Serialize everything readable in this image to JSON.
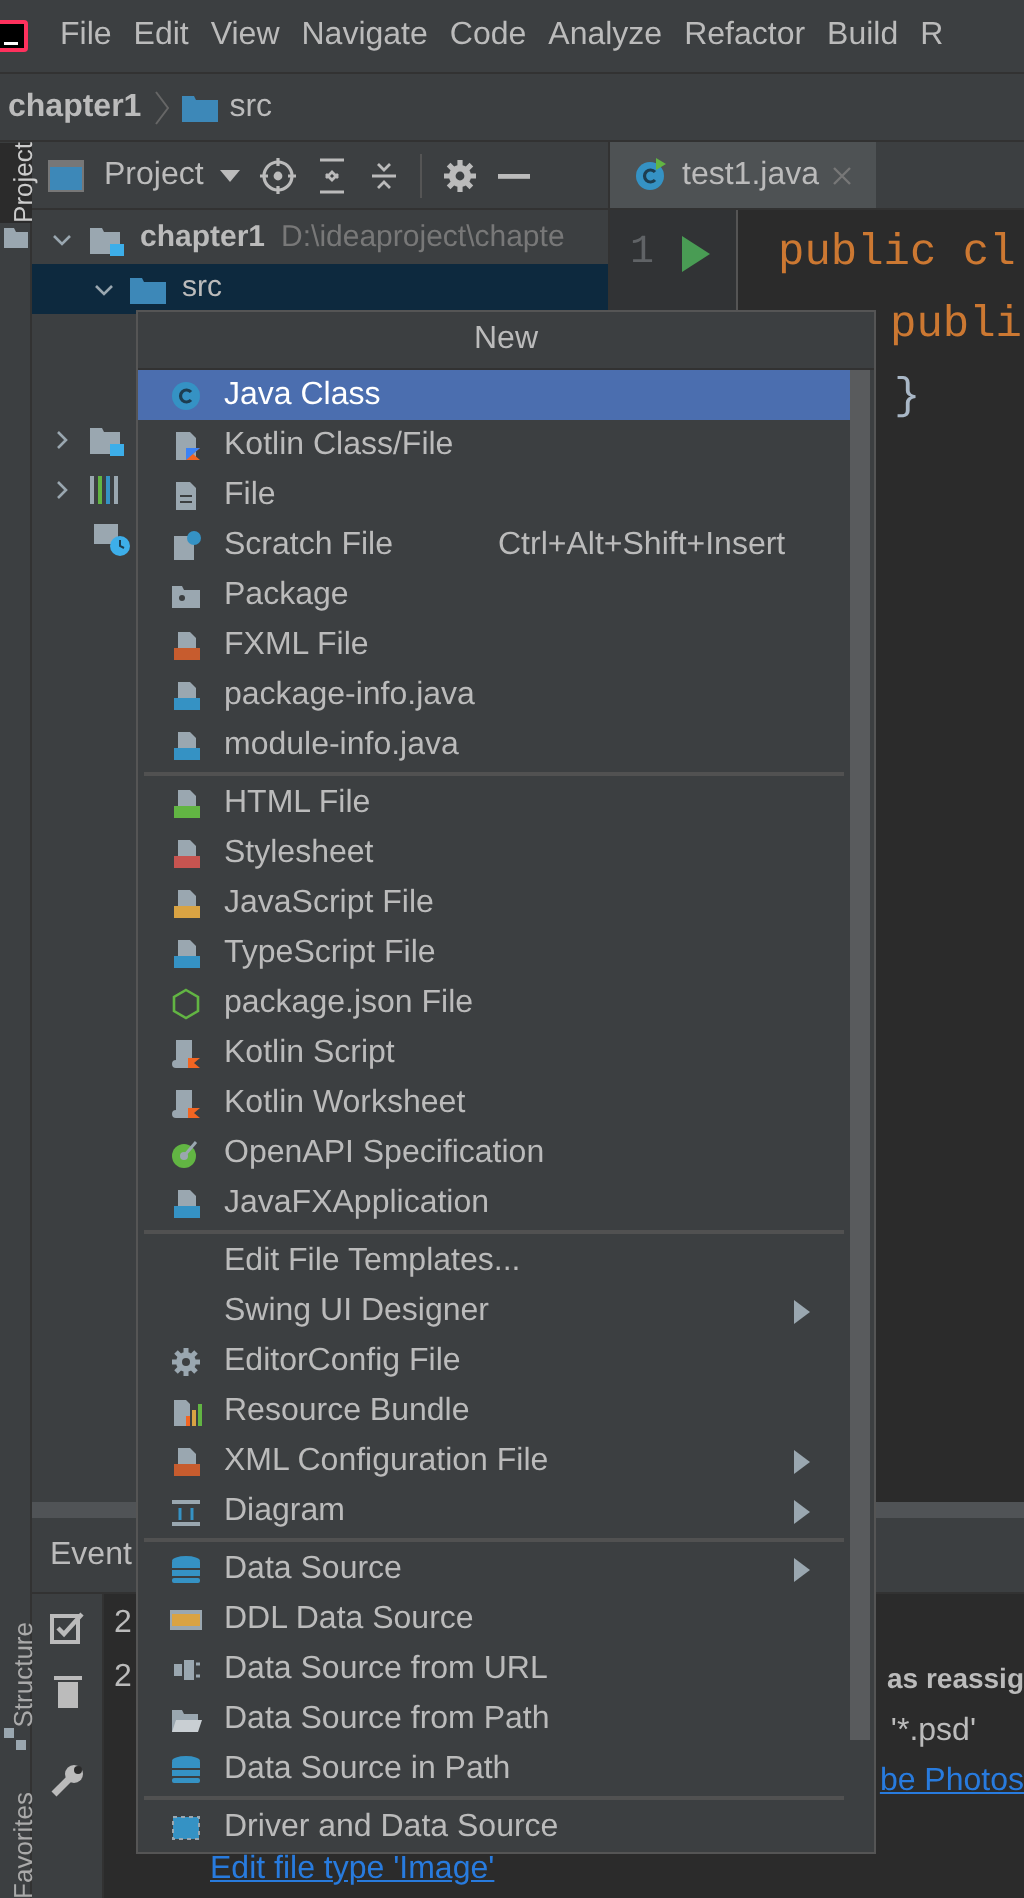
{
  "menu_bar": [
    "File",
    "Edit",
    "View",
    "Navigate",
    "Code",
    "Analyze",
    "Refactor",
    "Build",
    "R"
  ],
  "breadcrumbs": [
    "chapter1",
    "src"
  ],
  "side_tabs": [
    {
      "label": "Project",
      "selected": true
    },
    {
      "label": "Structure",
      "selected": false
    },
    {
      "label": "Favorites",
      "selected": false
    }
  ],
  "project_panel": {
    "title": "Project",
    "tree": [
      {
        "label": "chapter1",
        "path": "D:\\ideaproject\\chapte",
        "expanded": true,
        "selected": false,
        "children": [
          {
            "label": "src",
            "expanded": true,
            "selected": true
          }
        ]
      }
    ]
  },
  "editor": {
    "tabs": [
      {
        "label": "test1.java",
        "selected": true
      }
    ],
    "line_numbers": [
      "1"
    ],
    "code_lines": [
      "public cl",
      "publi",
      "}"
    ]
  },
  "event_log": {
    "title": "Event",
    "timestamps": [
      "2",
      "2"
    ],
    "message": "as reassig",
    "pattern": "'*.psd'",
    "links": [
      "be Photos",
      "Edit file type 'Image'"
    ]
  },
  "popup": {
    "title": "New",
    "sections": [
      [
        {
          "label": "Java Class",
          "selected": true,
          "submenu": false
        },
        {
          "label": "Kotlin Class/File",
          "selected": false,
          "submenu": false
        },
        {
          "label": "File",
          "selected": false,
          "submenu": false
        },
        {
          "label": "Scratch File",
          "shortcut": "Ctrl+Alt+Shift+Insert",
          "selected": false,
          "submenu": false
        },
        {
          "label": "Package",
          "selected": false,
          "submenu": false
        },
        {
          "label": "FXML File",
          "selected": false,
          "submenu": false
        },
        {
          "label": "package-info.java",
          "selected": false,
          "submenu": false
        },
        {
          "label": "module-info.java",
          "selected": false,
          "submenu": false
        }
      ],
      [
        {
          "label": "HTML File",
          "selected": false,
          "submenu": false
        },
        {
          "label": "Stylesheet",
          "selected": false,
          "submenu": false
        },
        {
          "label": "JavaScript File",
          "selected": false,
          "submenu": false
        },
        {
          "label": "TypeScript File",
          "selected": false,
          "submenu": false
        },
        {
          "label": "package.json File",
          "selected": false,
          "submenu": false
        },
        {
          "label": "Kotlin Script",
          "selected": false,
          "submenu": false
        },
        {
          "label": "Kotlin Worksheet",
          "selected": false,
          "submenu": false
        },
        {
          "label": "OpenAPI Specification",
          "selected": false,
          "submenu": false
        },
        {
          "label": "JavaFXApplication",
          "selected": false,
          "submenu": false
        }
      ],
      [
        {
          "label": "Edit File Templates...",
          "selected": false,
          "submenu": false
        },
        {
          "label": "Swing UI Designer",
          "selected": false,
          "submenu": true
        },
        {
          "label": "EditorConfig File",
          "selected": false,
          "submenu": false
        },
        {
          "label": "Resource Bundle",
          "selected": false,
          "submenu": false
        },
        {
          "label": "XML Configuration File",
          "selected": false,
          "submenu": true
        },
        {
          "label": "Diagram",
          "selected": false,
          "submenu": true
        }
      ],
      [
        {
          "label": "Data Source",
          "selected": false,
          "submenu": true
        },
        {
          "label": "DDL Data Source",
          "selected": false,
          "submenu": false
        },
        {
          "label": "Data Source from URL",
          "selected": false,
          "submenu": false
        },
        {
          "label": "Data Source from Path",
          "selected": false,
          "submenu": false
        },
        {
          "label": "Data Source in Path",
          "selected": false,
          "submenu": false
        }
      ],
      [
        {
          "label": "Driver and Data Source",
          "selected": false,
          "submenu": false
        }
      ]
    ]
  }
}
